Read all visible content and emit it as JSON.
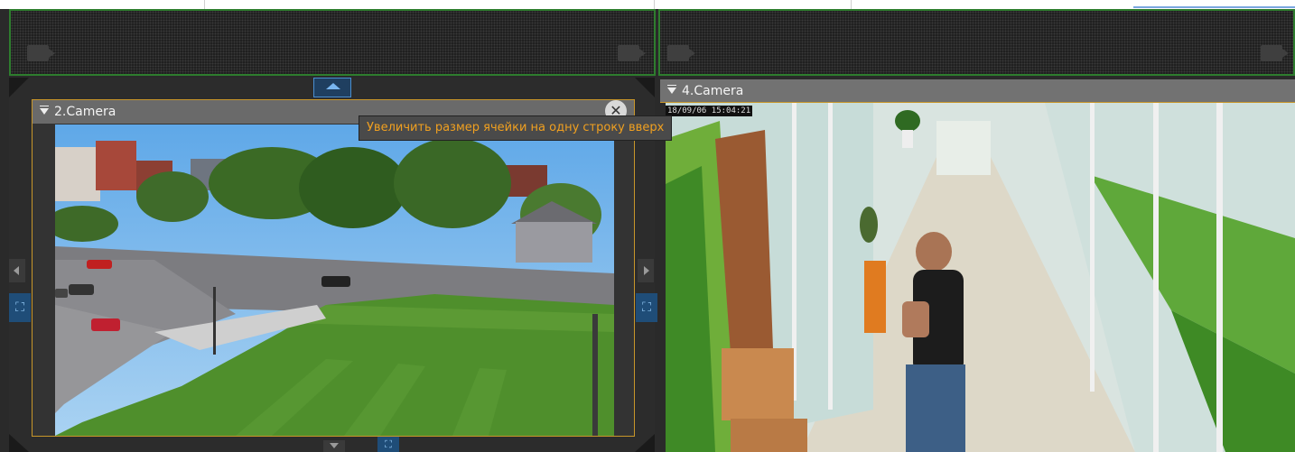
{
  "cameras": {
    "cam2": {
      "title": "2.Camera"
    },
    "cam4": {
      "title": "4.Camera",
      "osd_date": "18/09/06",
      "osd_time": "15:04:21"
    }
  },
  "tooltip": {
    "text": "Увеличить размер ячейки на одну строку вверх"
  },
  "icons": {
    "camera_off": "camera-off-icon",
    "close": "close-icon",
    "expand_up": "arrow-up-icon",
    "resize": "resize-icon"
  },
  "colors": {
    "active_border": "#c8962a",
    "tooltip_text": "#f0a020",
    "grid_green": "#2e7d2e",
    "resize_blue": "#1f4d78"
  }
}
